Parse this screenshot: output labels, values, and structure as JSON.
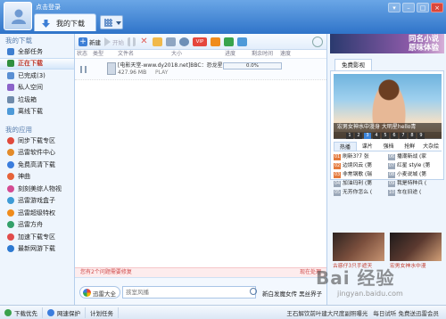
{
  "window": {
    "login_link": "点击登录",
    "tab_label": "我的下载",
    "controls": [
      "▾",
      "–",
      "□",
      "×"
    ]
  },
  "sidebar": {
    "my_downloads_heading": "我的下载",
    "my_downloads": [
      {
        "label": "全部任务",
        "color": "#3f7fd0",
        "active": false
      },
      {
        "label": "正在下载",
        "color": "#2f8f3e",
        "active": true
      },
      {
        "label": "已完成(3)",
        "color": "#5a8fd3",
        "active": false
      },
      {
        "label": "私人空间",
        "color": "#8b63c9",
        "active": false
      },
      {
        "label": "垃圾箱",
        "color": "#6f8bab",
        "active": false
      },
      {
        "label": "离线下载",
        "color": "#4e9ad8",
        "active": false
      }
    ],
    "my_apps_heading": "我的应用",
    "my_apps": [
      {
        "label": "同步下载专区",
        "color": "#e04a3c"
      },
      {
        "label": "迅雷软件中心",
        "color": "#e38b2a"
      },
      {
        "label": "免费高清下载",
        "color": "#3b7ddd"
      },
      {
        "label": "神曲",
        "color": "#e6633a"
      },
      {
        "label": "刻刻美综人物视",
        "color": "#d44b93"
      },
      {
        "label": "迅雷游戏盒子",
        "color": "#3e9bd6"
      },
      {
        "label": "迅雷超级特权",
        "color": "#f08c1c"
      },
      {
        "label": "迅雷方舟",
        "color": "#34a06a"
      },
      {
        "label": "加速下载专区",
        "color": "#e14c4c"
      },
      {
        "label": "最新网游下载",
        "color": "#2d79d1"
      }
    ]
  },
  "toolbar": {
    "new_label": "新建",
    "start_label": "开始",
    "vip_label": "VIP"
  },
  "columns": [
    "状态",
    "类型",
    "文件名",
    "大小",
    "进度",
    "剩余时间",
    "速度"
  ],
  "task": {
    "name": "[电影天堂-www.dy2018.net]BBC：恐龙星...",
    "size": "427.96 MB",
    "play_label": "PLAY",
    "progress_text": "0.0%",
    "progress_value": 0.0
  },
  "notice": {
    "text": "您有2个问题需要修复",
    "link": "现在处理"
  },
  "search": {
    "brand": "迅雷大全",
    "placeholder": "孩室风播",
    "hot_words": "新白发魔女传  黑丝界子"
  },
  "ad_panel": {
    "banner_line1": "同名小说",
    "banner_line2": "原味体验",
    "video_tab": "免费影视",
    "hero_caption": "宏男女神水中漫身 大明星hello青",
    "pages": [
      "1",
      "2",
      "3",
      "4",
      "5",
      "6",
      "7",
      "8",
      "9"
    ],
    "active_page": "3",
    "rank_tabs": [
      "热播",
      "谍片",
      "强档",
      "抢鲜",
      "大杂烩"
    ],
    "rank_items": [
      {
        "num": "01",
        "title": "刷新3?7 张"
      },
      {
        "num": "06",
        "title": "播潮新战 (家"
      },
      {
        "num": "02",
        "title": "边境风云 (第"
      },
      {
        "num": "07",
        "title": "红星 style (第"
      },
      {
        "num": "03",
        "title": "非常钢歌 (瑞"
      },
      {
        "num": "08",
        "title": "小麦说城 (第"
      },
      {
        "num": "04",
        "title": "加油玛利 (第"
      },
      {
        "num": "09",
        "title": "我是特种兵 ("
      },
      {
        "num": "05",
        "title": "无芳你怎么 ("
      },
      {
        "num": "10",
        "title": "车在旧途 ("
      }
    ],
    "thumb_captions": [
      "古惑仔3只手遮天",
      "宏男女神水中漫"
    ]
  },
  "watermark": {
    "brand": "Bai 经验",
    "sub": "jingyan.baidu.com"
  },
  "status": {
    "download_priority": "下载优先",
    "network_protect": "网速保护",
    "scheduled": "计划任务",
    "news": "王石解饮前叶建大尺度副照曝光",
    "speed": "每日试听 免费送迅雷会员"
  }
}
